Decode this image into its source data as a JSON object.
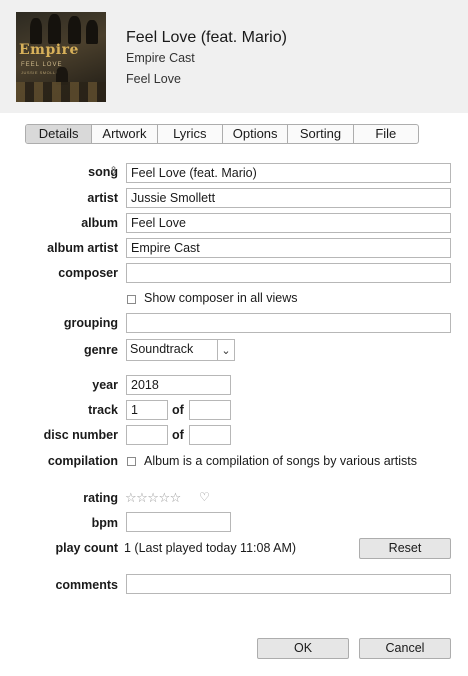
{
  "header": {
    "title": "Feel Love (feat. Mario)",
    "artist": "Empire Cast",
    "album": "Feel Love",
    "artwork": {
      "logo_text": "Empire",
      "line1": "FEEL LOVE",
      "line2": "JUSSIE SMOLLETT"
    }
  },
  "tabs": [
    {
      "label": "Details",
      "active": true
    },
    {
      "label": "Artwork",
      "active": false
    },
    {
      "label": "Lyrics",
      "active": false
    },
    {
      "label": "Options",
      "active": false
    },
    {
      "label": "Sorting",
      "active": false
    },
    {
      "label": "File",
      "active": false
    }
  ],
  "fields": {
    "song": {
      "label": "song",
      "value": "Feel Love (feat. Mario)"
    },
    "artist": {
      "label": "artist",
      "value": "Jussie Smollett"
    },
    "album": {
      "label": "album",
      "value": "Feel Love"
    },
    "album_artist": {
      "label": "album artist",
      "value": "Empire Cast"
    },
    "composer": {
      "label": "composer",
      "value": ""
    },
    "show_composer": {
      "label": "Show composer in all views",
      "checked": false
    },
    "grouping": {
      "label": "grouping",
      "value": ""
    },
    "genre": {
      "label": "genre",
      "value": "Soundtrack"
    },
    "year": {
      "label": "year",
      "value": "2018"
    },
    "track": {
      "label": "track",
      "value": "1",
      "of_label": "of",
      "of_value": ""
    },
    "disc_number": {
      "label": "disc number",
      "value": "",
      "of_label": "of",
      "of_value": ""
    },
    "compilation": {
      "label": "compilation",
      "checkbox_label": "Album is a compilation of songs by various artists",
      "checked": false
    },
    "rating": {
      "label": "rating",
      "value": "☆☆☆☆☆",
      "stars": 0,
      "max_stars": 5
    },
    "bpm": {
      "label": "bpm",
      "value": ""
    },
    "play_count": {
      "label": "play count",
      "value": "1 (Last played today 11:08 AM)",
      "reset_label": "Reset"
    },
    "comments": {
      "label": "comments",
      "value": ""
    }
  },
  "footer": {
    "ok_label": "OK",
    "cancel_label": "Cancel"
  },
  "icons": {
    "sort": "sort-updown-icon",
    "dropdown": "chevron-down-icon",
    "heart": "heart-icon"
  }
}
